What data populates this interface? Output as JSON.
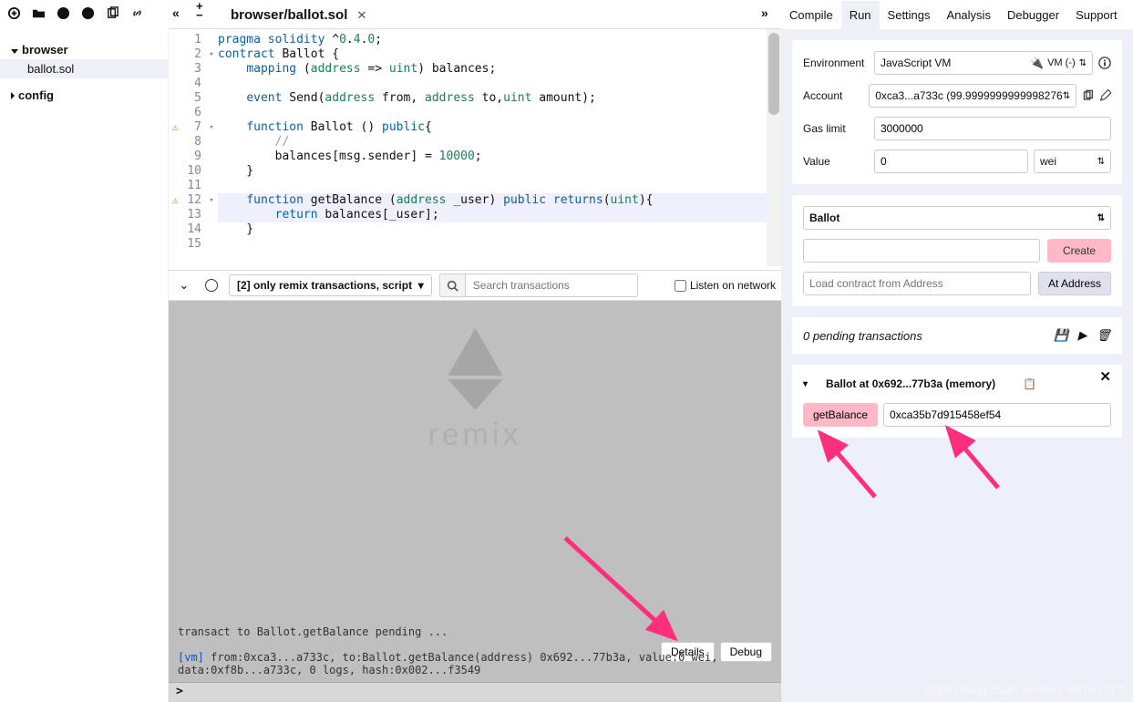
{
  "iconbar": {
    "names": [
      "new-file-icon",
      "open-icon",
      "github-icon",
      "github-alt-icon",
      "copy-icon",
      "link-icon"
    ]
  },
  "filetree": {
    "browser_label": "browser",
    "file_label": "ballot.sol",
    "config_label": "config"
  },
  "tab": {
    "title": "browser/ballot.sol"
  },
  "editor": {
    "lines": [
      {
        "n": 1,
        "warn": "",
        "fold": "",
        "raw": "pragma solidity ^0.4.0;",
        "hl": false
      },
      {
        "n": 2,
        "warn": "",
        "fold": "▾",
        "raw": "contract Ballot {",
        "hl": false
      },
      {
        "n": 3,
        "warn": "",
        "fold": "",
        "raw": "    mapping (address => uint) balances;",
        "hl": false
      },
      {
        "n": 4,
        "warn": "",
        "fold": "",
        "raw": "",
        "hl": false
      },
      {
        "n": 5,
        "warn": "",
        "fold": "",
        "raw": "    event Send(address from, address to,uint amount);",
        "hl": false
      },
      {
        "n": 6,
        "warn": "",
        "fold": "",
        "raw": "",
        "hl": false
      },
      {
        "n": 7,
        "warn": "⚠",
        "fold": "▾",
        "raw": "    function Ballot () public{",
        "hl": false
      },
      {
        "n": 8,
        "warn": "",
        "fold": "",
        "raw": "        //",
        "hl": false
      },
      {
        "n": 9,
        "warn": "",
        "fold": "",
        "raw": "        balances[msg.sender] = 10000;",
        "hl": false
      },
      {
        "n": 10,
        "warn": "",
        "fold": "",
        "raw": "    }",
        "hl": false
      },
      {
        "n": 11,
        "warn": "",
        "fold": "",
        "raw": "",
        "hl": false
      },
      {
        "n": 12,
        "warn": "⚠",
        "fold": "▾",
        "raw": "    function getBalance (address _user) public returns(uint){",
        "hl": true
      },
      {
        "n": 13,
        "warn": "",
        "fold": "",
        "raw": "        return balances[_user];",
        "hl": true
      },
      {
        "n": 14,
        "warn": "",
        "fold": "",
        "raw": "    }",
        "hl": false
      },
      {
        "n": 15,
        "warn": "",
        "fold": "",
        "raw": "",
        "hl": false
      }
    ]
  },
  "termbar": {
    "filter_label": "[2] only remix transactions, script",
    "search_placeholder": "Search transactions",
    "listen_label": "Listen on network"
  },
  "console": {
    "brand": "remix",
    "pending": "transact to Ballot.getBalance pending ...",
    "vm_prefix": "[vm]",
    "vm_rest": " from:0xca3...a733c, to:Ballot.getBalance(address) 0x692...77b3a, value:0 wei, data:0xf8b...a733c, 0 logs, hash:0x002...f3549",
    "details_label": "Details",
    "debug_label": "Debug",
    "prompt": ">"
  },
  "rtabs": {
    "compile": "Compile",
    "run": "Run",
    "settings": "Settings",
    "analysis": "Analysis",
    "debugger": "Debugger",
    "support": "Support"
  },
  "env_card": {
    "env_lbl": "Environment",
    "env_val": "JavaScript VM",
    "env_suffix": "VM (-)",
    "acct_lbl": "Account",
    "acct_val": "0xca3...a733c (99.9999999999998276",
    "gas_lbl": "Gas limit",
    "gas_val": "3000000",
    "value_lbl": "Value",
    "value_val": "0",
    "unit_val": "wei"
  },
  "deploy_card": {
    "contract": "Ballot",
    "create_label": "Create",
    "load_placeholder": "Load contract from Address",
    "at_address_label": "At Address"
  },
  "pending_card": {
    "text": "0 pending transactions"
  },
  "instance_card": {
    "title": "Ballot at 0x692...77b3a (memory)",
    "fn_name": "getBalance",
    "fn_input": "0xca35b7d915458ef54"
  },
  "watermark": "https://blog.csdn.net/m0_48741717"
}
